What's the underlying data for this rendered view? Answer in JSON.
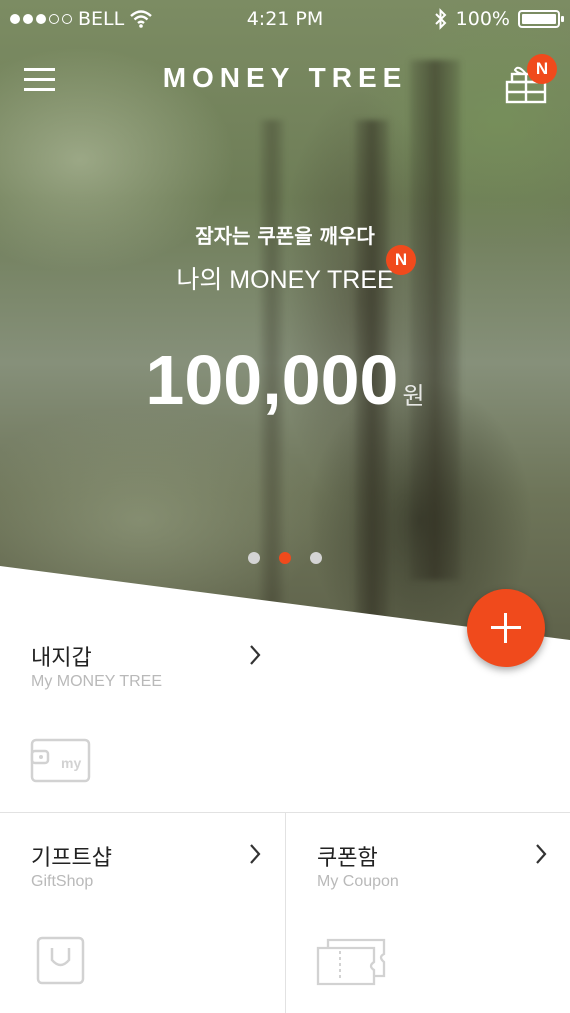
{
  "status_bar": {
    "carrier": "BELL",
    "time": "4:21 PM",
    "battery": "100%"
  },
  "nav": {
    "title": "MONEY TREE",
    "gift_badge": "N"
  },
  "hero": {
    "subtitle": "잠자는 쿠폰을 깨우다",
    "title": "나의 MONEY TREE",
    "title_badge": "N",
    "amount": "100,000",
    "unit": "원",
    "pager_count": 3,
    "pager_active_index": 1
  },
  "cards": {
    "wallet": {
      "title": "내지갑",
      "subtitle": "My MONEY TREE",
      "icon": "wallet-my-icon"
    },
    "giftshop": {
      "title": "기프트샵",
      "subtitle": "GiftShop",
      "icon": "shopping-bag-icon"
    },
    "coupon": {
      "title": "쿠폰함",
      "subtitle": "My Coupon",
      "icon": "coupon-ticket-icon"
    }
  },
  "colors": {
    "accent": "#f04a1c",
    "muted_text": "#b9b9b9",
    "icon_gray": "#d2d2d2"
  }
}
